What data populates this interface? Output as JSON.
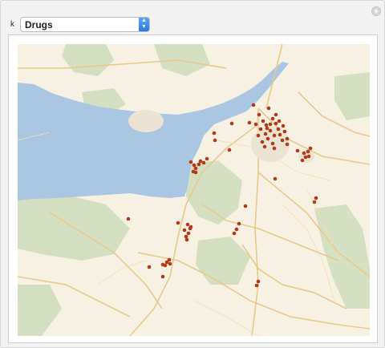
{
  "control": {
    "label": "k",
    "selected": "Drugs"
  },
  "map": {
    "marker_color": "#b23a16"
  }
}
